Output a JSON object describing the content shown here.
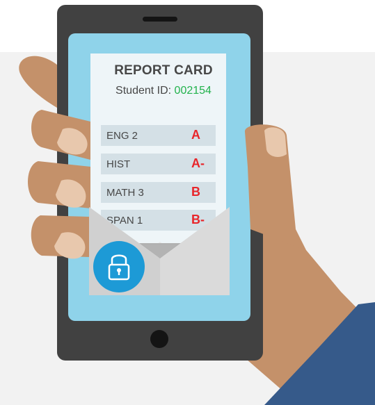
{
  "report_card": {
    "title": "REPORT CARD",
    "student_id_label": "Student ID: ",
    "student_id_value": "002154",
    "grades": [
      {
        "subject": "ENG 2",
        "grade": "A"
      },
      {
        "subject": "HIST",
        "grade": "A-"
      },
      {
        "subject": "MATH 3",
        "grade": "B"
      },
      {
        "subject": "SPAN 1",
        "grade": "B-"
      }
    ]
  },
  "icons": [
    "padlock-icon"
  ],
  "colors": {
    "background_panel": "#f2f2f2",
    "phone_body": "#414141",
    "screen": "#8fd3ea",
    "card": "#eef5f8",
    "row": "#d4e0e6",
    "grade_text": "#e8252a",
    "student_id_text": "#22b24c",
    "lock_circle": "#1d9ad6",
    "skin": "#c4916a",
    "sleeve": "#365a8a"
  }
}
